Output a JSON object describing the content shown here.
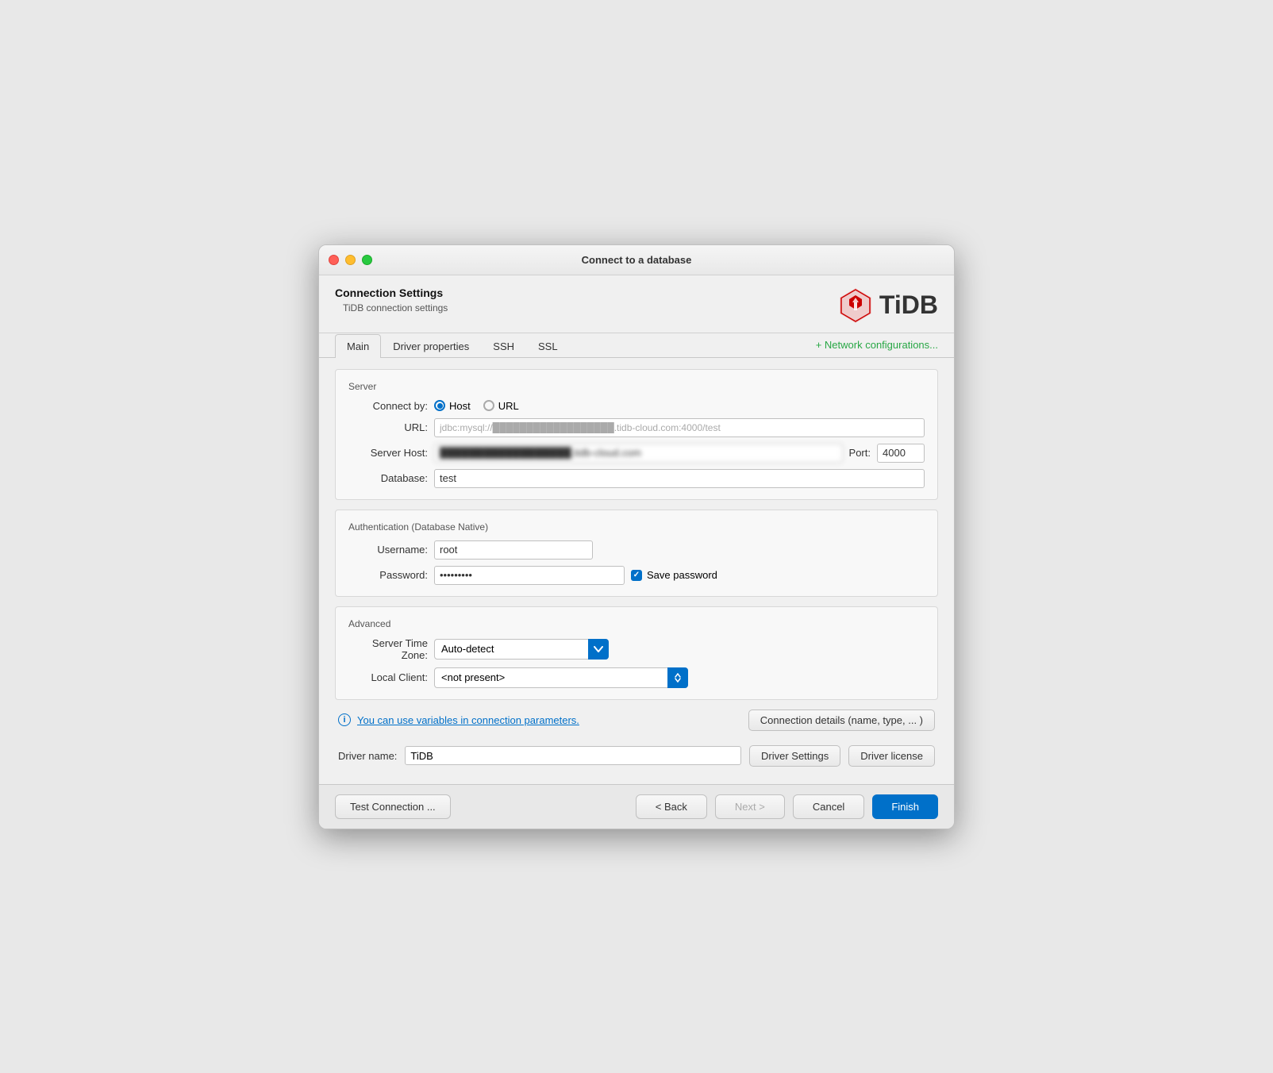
{
  "window": {
    "title": "Connect to a database"
  },
  "header": {
    "section_title": "Connection Settings",
    "subtitle": "TiDB connection settings",
    "logo_text": "TiDB"
  },
  "tabs": {
    "items": [
      {
        "label": "Main",
        "active": true
      },
      {
        "label": "Driver properties",
        "active": false
      },
      {
        "label": "SSH",
        "active": false
      },
      {
        "label": "SSL",
        "active": false
      }
    ],
    "network_config_label": "+ Network configurations..."
  },
  "server_section": {
    "title": "Server",
    "connect_by_label": "Connect by:",
    "host_option": "Host",
    "url_option": "URL",
    "url_label": "URL:",
    "url_placeholder": "jdbc:mysql://██████████████████████.tidb-cloud.com:4000/test",
    "server_host_label": "Server Host:",
    "server_host_value": "██████████████████████.tidb-cloud.com",
    "port_label": "Port:",
    "port_value": "4000",
    "database_label": "Database:",
    "database_value": "test"
  },
  "auth_section": {
    "title": "Authentication (Database Native)",
    "username_label": "Username:",
    "username_value": "root",
    "password_label": "Password:",
    "password_value": "••••••••",
    "save_password_label": "Save password"
  },
  "advanced_section": {
    "title": "Advanced",
    "timezone_label": "Server Time Zone:",
    "timezone_value": "Auto-detect",
    "local_client_label": "Local Client:",
    "local_client_value": "<not present>"
  },
  "footer": {
    "info_text": "You can use variables in connection parameters.",
    "connection_details_btn": "Connection details (name, type, ... )"
  },
  "driver": {
    "label": "Driver name:",
    "value": "TiDB",
    "settings_btn": "Driver Settings",
    "license_btn": "Driver license"
  },
  "bottom_bar": {
    "test_btn": "Test Connection ...",
    "back_btn": "< Back",
    "next_btn": "Next >",
    "cancel_btn": "Cancel",
    "finish_btn": "Finish"
  }
}
